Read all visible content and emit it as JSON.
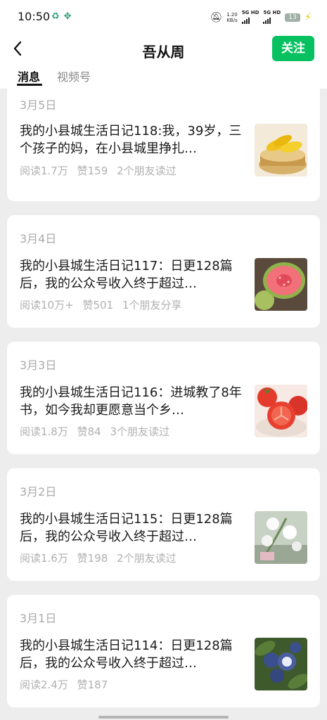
{
  "status_bar": {
    "time": "10:50",
    "speed_value": "1.20",
    "speed_unit": "KB/s",
    "network1": "5G HD",
    "network2": "5G HD",
    "battery": "13"
  },
  "header": {
    "title": "吾从周",
    "follow_label": "关注"
  },
  "tabs": [
    {
      "label": "消息",
      "active": true
    },
    {
      "label": "视频号",
      "active": false
    }
  ],
  "articles": [
    {
      "date": "3月5日",
      "headline": "我的小县城生活日记118:我，39岁，三个孩子的妈，在小县城里挣扎…",
      "reads": "阅读1.7万",
      "likes": "赞159",
      "social": "2个朋友读过",
      "thumb_icon": "corn-steamer-thumbnail"
    },
    {
      "date": "3月4日",
      "headline": "我的小县城生活日记117：日更128篇后，我的公众号收入终于超过…",
      "reads": "阅读10万+",
      "likes": "赞501",
      "social": "1个朋友分享",
      "thumb_icon": "guava-thumbnail"
    },
    {
      "date": "3月3日",
      "headline": "我的小县城生活日记116：进城教了8年书，如今我却更愿意当个乡…",
      "reads": "阅读1.8万",
      "likes": "赞84",
      "social": "3个朋友读过",
      "thumb_icon": "tomato-thumbnail"
    },
    {
      "date": "3月2日",
      "headline": "我的小县城生活日记115：日更128篇后，我的公众号收入终于超过…",
      "reads": "阅读1.6万",
      "likes": "赞198",
      "social": "2个朋友读过",
      "thumb_icon": "white-flowers-thumbnail"
    },
    {
      "date": "3月1日",
      "headline": "我的小县城生活日记114：日更128篇后，我的公众号收入终于超过…",
      "reads": "阅读2.4万",
      "likes": "赞187",
      "social": "",
      "thumb_icon": "blueberry-thumbnail"
    }
  ],
  "colors": {
    "accent": "#07c160",
    "background": "#ededed",
    "card": "#ffffff",
    "muted_text": "#b0b0b0"
  }
}
